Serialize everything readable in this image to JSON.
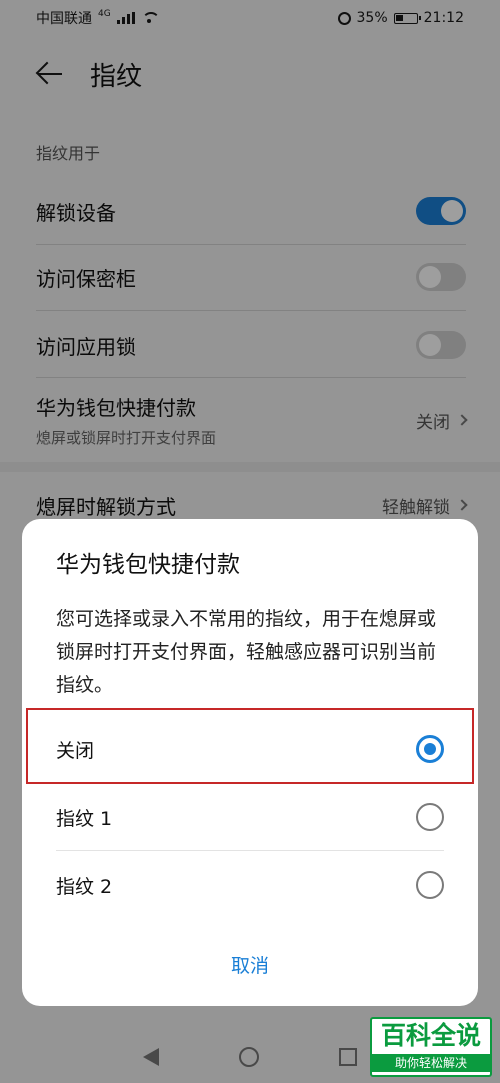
{
  "statusbar": {
    "carrier": "中国联通",
    "network_tag": "4G",
    "battery": "35%",
    "time": "21:12"
  },
  "header": {
    "title": "指纹"
  },
  "section": {
    "label": "指纹用于"
  },
  "settings": {
    "unlock": {
      "label": "解锁设备",
      "on": true
    },
    "safe": {
      "label": "访问保密柜",
      "on": false
    },
    "applock": {
      "label": "访问应用锁",
      "on": false
    },
    "wallet": {
      "label": "华为钱包快捷付款",
      "sub": "熄屏或锁屏时打开支付界面",
      "value": "关闭"
    },
    "screenoff": {
      "label": "熄屏时解锁方式",
      "value": "轻触解锁"
    }
  },
  "dialog": {
    "title": "华为钱包快捷付款",
    "description": "您可选择或录入不常用的指纹，用于在熄屏或锁屏时打开支付界面，轻触感应器可识别当前指纹。",
    "options": [
      {
        "label": "关闭",
        "selected": true
      },
      {
        "label": "指纹 1",
        "selected": false
      },
      {
        "label": "指纹 2",
        "selected": false
      }
    ],
    "cancel_label": "取消"
  },
  "watermark": {
    "main": "百科全说",
    "sub": "助你轻松解决"
  },
  "colors": {
    "accent": "#1a7fd6",
    "highlight": "#c62828",
    "watermark": "#0b9b3f"
  }
}
